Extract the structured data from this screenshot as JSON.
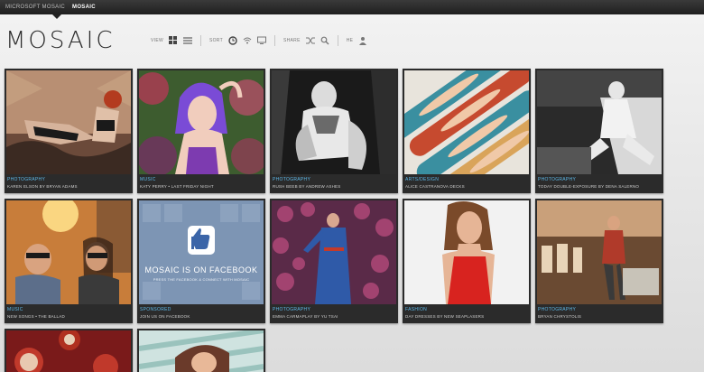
{
  "topbar": {
    "left_label": "MICROSOFT MOSAIC",
    "active_label": "MOSAIC"
  },
  "logo": "MOSAIC",
  "toolbar": {
    "view_label": "VIEW",
    "sort_label": "SORT",
    "share_label": "SHARE",
    "help_label": "HE"
  },
  "tiles": [
    {
      "category": "PHOTOGRAPHY",
      "title": "KAREN ELSON BY BRYAN ADAMS"
    },
    {
      "category": "MUSIC",
      "title": "KATY PERRY • LAST FRIDAY NIGHT"
    },
    {
      "category": "PHOTOGRAPHY",
      "title": "RUSH BEEB BY ANDREW ASHES"
    },
    {
      "category": "ARTS/DESIGN",
      "title": "ALICE CASTRANOVA DECKS"
    },
    {
      "category": "PHOTOGRAPHY",
      "title": "TODAY DOUBLE-EXPOSURE BY DENA SALERNO"
    },
    {
      "category": "MUSIC",
      "title": "NEW SONGS • THE BALLAD"
    },
    {
      "category": "SPONSORED",
      "title": "JOIN US ON FACEBOOK"
    },
    {
      "category": "PHOTOGRAPHY",
      "title": "EMMA CARMAPLAY BY YU TSAI"
    },
    {
      "category": "FASHION",
      "title": "DAY DRESSES BY NEW SEAPLASERS"
    },
    {
      "category": "PHOTOGRAPHY",
      "title": "BRYAN CHRYSTOLIS"
    }
  ],
  "facebook_tile": {
    "line1": "MOSAIC IS ON FACEBOOK",
    "line2": "PRESS THE FACEBOOK & CONNECT WITH MOSAIC"
  },
  "colors": {
    "accent": "#5db8e8",
    "tile_bg": "#2b2b2b",
    "topbar": "#222222"
  }
}
